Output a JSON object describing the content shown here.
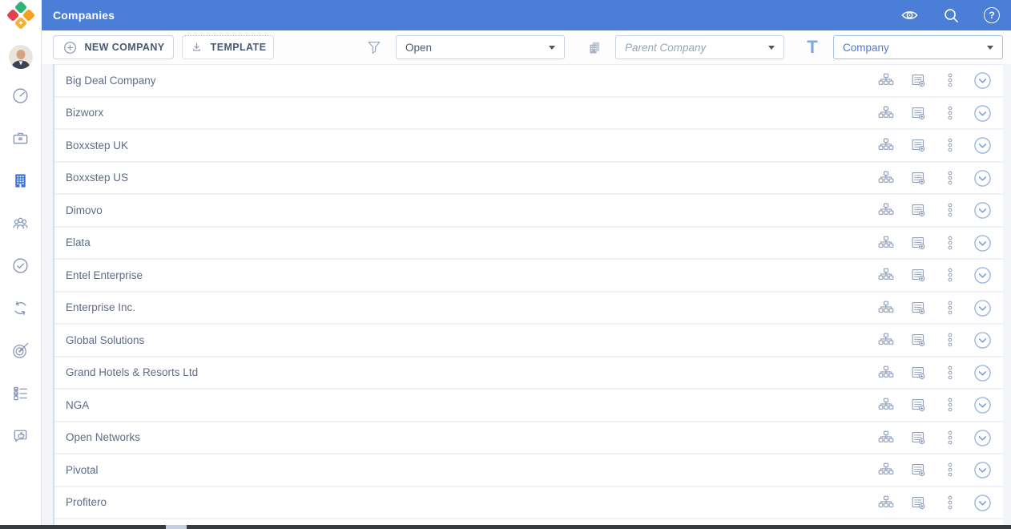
{
  "header": {
    "title": "Companies",
    "help_glyph": "?",
    "icons": [
      "eye-icon",
      "search-icon",
      "help-icon"
    ]
  },
  "sidebar": {
    "icons": [
      "user-avatar",
      "gauge-dashboard-icon",
      "briefcase-icon",
      "building-companies-icon",
      "people-contacts-icon",
      "check-circle-icon",
      "sync-arrows-icon",
      "target-icon",
      "checklist-icon",
      "feedback-bubble-icon"
    ],
    "active_icon": "building-companies-icon"
  },
  "toolbar": {
    "new_company_label": "NEW COMPANY",
    "template_label": "TEMPLATE",
    "status_filter_value": "Open",
    "parent_company_placeholder": "Parent Company",
    "sort_field_value": "Company",
    "sort_glyph": "T",
    "icons": [
      "plus-circle-icon",
      "download-icon",
      "filter-funnel-icon",
      "parent-company-buildings-icon",
      "text-sort-icon"
    ]
  },
  "list": {
    "companies": [
      "Big Deal Company",
      "Bizworx",
      "Boxxstep UK",
      "Boxxstep US",
      "Dimovo",
      "Elata",
      "Entel Enterprise",
      "Enterprise Inc.",
      "Global Solutions",
      "Grand Hotels & Resorts Ltd",
      "NGA",
      "Open Networks",
      "Pivotal",
      "Profitero"
    ],
    "row_action_icons": [
      "org-chart-icon",
      "notes-add-icon",
      "more-options-icon",
      "expand-chevron-icon"
    ]
  },
  "colors": {
    "header_blue": "#4b7ed6",
    "active_nav_blue": "#3d73da",
    "link_blue": "#4a7cd0",
    "text_slate": "#5e6c87",
    "icon_slate": "#8e9cb8",
    "logo_green": "#2fb573",
    "logo_red": "#e5404e",
    "logo_orange": "#f5a11d",
    "logo_amber": "#f8af2e",
    "bottom_bar_dark": "#363a41"
  }
}
